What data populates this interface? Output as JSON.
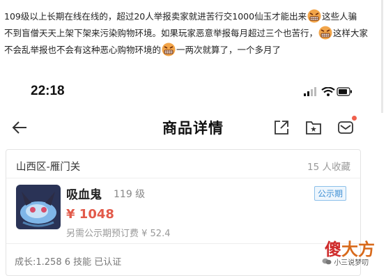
{
  "post": {
    "line1_a": "109级以上长期在线在线的，超过20人举报卖家就进苦行交1000仙玉才能出来",
    "line1_b": "这些人骗",
    "line2_a": "不到盲僧天天上架下架来污染购物环境。如果玩家恶意举报每月超过三个也苦行，",
    "line2_b": "这样大家",
    "line3_a": "不会乱举报也不会有这种恶心购物环境的",
    "line3_b": "一两次就算了，一个多月了"
  },
  "status": {
    "time": "22:18"
  },
  "nav": {
    "title": "商品详情"
  },
  "item": {
    "region": "山西区-雁门关",
    "collect": "15 人收藏",
    "name": "吸血鬼",
    "level": "119 级",
    "tag": "公示期",
    "price": "¥ 1048",
    "fee": "另需公示期预订费 ¥ 52.4",
    "growth": "成长:1.258  6 技能  已认证"
  },
  "watermark": {
    "big_a": "傻",
    "big_b": "大方",
    "small": "小三说梦叨"
  },
  "colors": {
    "price": "#e25a4a",
    "tag": "#3e8fd4",
    "watermark": "#cf2b2b"
  }
}
